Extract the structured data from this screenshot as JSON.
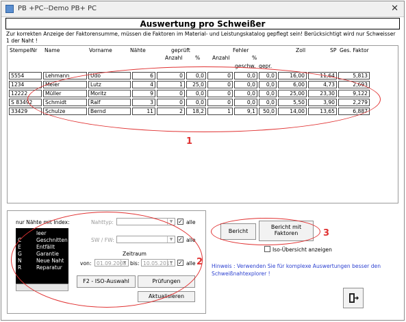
{
  "window": {
    "title": "PB +PC--Demo PB+ PC",
    "close": "✕"
  },
  "header": {
    "title": "Auswertung pro Schweißer"
  },
  "notice": "Zur korrekten Anzeige der Faktorensumme, müssen die Faktoren im Material- und Leistungskatalog gepflegt sein! Berücksichtigt wird nur Schweisser 1 der Naht !",
  "table": {
    "headers": {
      "stempelnr": "StempelNr",
      "name": "Name",
      "vorname": "Vorname",
      "naehte": "Nähte",
      "geprueft": "geprüft",
      "fehler": "Fehler",
      "zoll": "Zoll",
      "sp": "SP",
      "ges_faktor": "Ges. Faktor",
      "anzahl1": "Anzahl",
      "pct1": "%",
      "anzahl2": "Anzahl",
      "pct2": "%",
      "geschw": "geschw.",
      "gepr": "gepr."
    },
    "rows": [
      [
        "5554",
        "Lehmann",
        "Udo",
        "6",
        "0",
        "0,0",
        "0",
        "0,0",
        "0,0",
        "16,00",
        "11,64",
        "5,813"
      ],
      [
        "1234",
        "Meier",
        "Lutz",
        "4",
        "1",
        "25,0",
        "0",
        "0,0",
        "0,0",
        "6,00",
        "4,73",
        "2,693"
      ],
      [
        "12222",
        "Müller",
        "Moritz",
        "9",
        "0",
        "0,0",
        "0",
        "0,0",
        "0,0",
        "25,00",
        "23,30",
        "9,122"
      ],
      [
        "S 83492",
        "Schmidt",
        "Ralf",
        "3",
        "0",
        "0,0",
        "0",
        "0,0",
        "0,0",
        "5,50",
        "3,90",
        "2,279"
      ],
      [
        "33429",
        "Schulze",
        "Bernd",
        "11",
        "2",
        "18,2",
        "1",
        "9,1",
        "50,0",
        "14,00",
        "13,65",
        "6,887"
      ]
    ]
  },
  "filters": {
    "index_label": "nur Nähte mit Index:",
    "index_items": [
      {
        "key": "",
        "text": "leer"
      },
      {
        "key": "C",
        "text": "Geschnitten (Cu"
      },
      {
        "key": "E",
        "text": "Entfällt"
      },
      {
        "key": "G",
        "text": "Garantie"
      },
      {
        "key": "N",
        "text": "Neue Naht"
      },
      {
        "key": "R",
        "text": "Reparatur"
      }
    ],
    "nahttyp_label": "Nahttyp:",
    "swfw_label": "SW / FW:",
    "alle1": "alle",
    "alle2": "alle",
    "alle3": "alle",
    "zeitraum_label": "Zeitraum",
    "von_label": "von:",
    "von_value": "01.09.2008",
    "bis_label": "bis:",
    "bis_value": "10.05.2011",
    "iso_button": "F2 - ISO-Auswahl",
    "pruefungen_button": "Prüfungen",
    "aktualisieren_button": "Aktualisieren"
  },
  "report": {
    "bericht_button": "Bericht",
    "bericht_faktoren_line1": "Bericht mit",
    "bericht_faktoren_line2": "Faktoren",
    "iso_overview_label": "Iso-Übersicht anzeigen",
    "hint": "Hinweis : Verwenden Sie für komplexe Auswertungen besser den Schweißnahtexplorer !"
  },
  "annotations": {
    "n1": "1",
    "n2": "2",
    "n3": "3"
  },
  "colors": {
    "annotation": "#e03030",
    "hint": "#2a3fd0",
    "listbox_bg": "#000000"
  }
}
